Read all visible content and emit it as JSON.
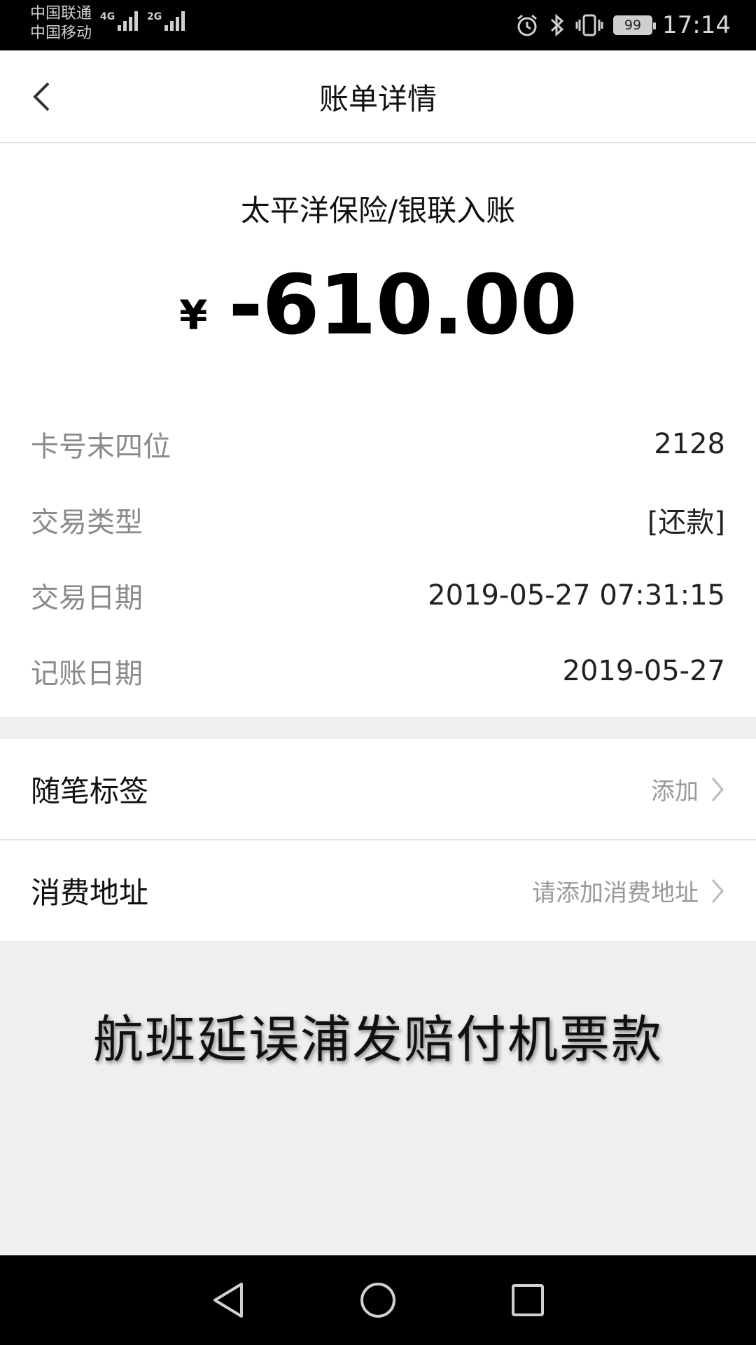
{
  "status_bar": {
    "carrier_1": "中国联通",
    "carrier_2": "中国移动",
    "net_1": "4G",
    "net_2": "2G",
    "battery": "99",
    "time": "17:14"
  },
  "header": {
    "title": "账单详情"
  },
  "detail": {
    "merchant": "太平洋保险/银联入账",
    "currency_symbol": "¥",
    "amount": "-610.00",
    "rows": [
      {
        "label": "卡号末四位",
        "value": "2128"
      },
      {
        "label": "交易类型",
        "value": "[还款]"
      },
      {
        "label": "交易日期",
        "value": "2019-05-27 07:31:15"
      },
      {
        "label": "记账日期",
        "value": "2019-05-27"
      }
    ]
  },
  "options": {
    "tags": {
      "label": "随笔标签",
      "hint": "添加"
    },
    "address": {
      "label": "消费地址",
      "hint": "请添加消费地址"
    }
  },
  "caption": "航班延误浦发赔付机票款",
  "colors": {
    "status_bar_bg": "#000000",
    "page_bg": "#efefef",
    "card_bg": "#ffffff",
    "label_gray": "#8a8a8a",
    "hint_gray": "#999999"
  }
}
